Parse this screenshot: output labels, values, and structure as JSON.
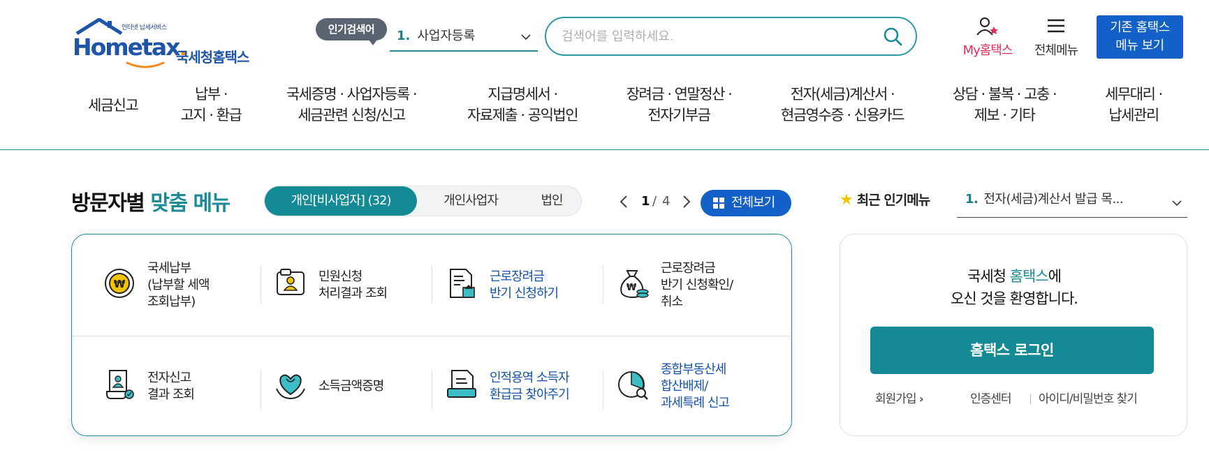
{
  "header": {
    "logo": {
      "small_text": "인터넷 납세서비스",
      "brand_text": "Hometax",
      "korean_text": "국세청홈택스"
    },
    "popular_search": {
      "badge": "인기검색어",
      "rank": "1.",
      "term": "사업자등록"
    },
    "search": {
      "placeholder": "검색어를 입력하세요."
    },
    "my_hometax_label": "My홈택스",
    "all_menu_label": "전체메뉴",
    "old_home_label_1": "기존 홈택스",
    "old_home_label_2": "메뉴 보기"
  },
  "gnb": [
    {
      "line1": "세금신고",
      "line2": ""
    },
    {
      "line1": "납부 ·",
      "line2": "고지 · 환급"
    },
    {
      "line1": "국세증명 · 사업자등록 ·",
      "line2": "세금관련 신청/신고"
    },
    {
      "line1": "지급명세서 ·",
      "line2": "자료제출 · 공익법인"
    },
    {
      "line1": "장려금 · 연말정산 ·",
      "line2": "전자기부금"
    },
    {
      "line1": "전자(세금)계산서 ·",
      "line2": "현금영수증 · 신용카드"
    },
    {
      "line1": "상담 · 불복 · 고충 ·",
      "line2": "제보 · 기타"
    },
    {
      "line1": "세무대리 ·",
      "line2": "납세관리"
    }
  ],
  "visitor_menu": {
    "title_prefix": "방문자별",
    "title_accent": "맞춤 메뉴",
    "tabs": [
      "개인[비사업자] (32)",
      "개인사업자",
      "법인"
    ],
    "active_tab": 0,
    "page_current": "1",
    "page_sep": "/",
    "page_total": "4",
    "view_all_label": "전체보기",
    "items": [
      {
        "label": "국세납부\n(납부할 세액\n조회납부)",
        "icon": "tax-payment-coin-icon",
        "highlight": false
      },
      {
        "label": "민원신청\n처리결과 조회",
        "icon": "petition-result-icon",
        "highlight": false
      },
      {
        "label": "근로장려금\n반기 신청하기",
        "icon": "incentive-apply-icon",
        "highlight": true
      },
      {
        "label": "근로장려금\n반기 신청확인/\n취소",
        "icon": "money-bag-icon",
        "highlight": false
      },
      {
        "label": "전자신고\n결과 조회",
        "icon": "e-filing-result-icon",
        "highlight": false
      },
      {
        "label": "소득금액증명",
        "icon": "income-certificate-icon",
        "highlight": false
      },
      {
        "label": "인적용역 소득자\n환급금 찾아주기",
        "icon": "refund-finder-icon",
        "highlight": true
      },
      {
        "label": "종합부동산세\n합산배제/\n과세특례 신고",
        "icon": "property-tax-chart-icon",
        "highlight": true
      }
    ]
  },
  "recent_popular": {
    "label": "최근 인기메뉴",
    "rank": "1.",
    "item": "전자(세금)계산서 발급 목..."
  },
  "login_panel": {
    "welcome_1_prefix": "국세청",
    "welcome_1_accent": "홈택스",
    "welcome_1_suffix": "에",
    "welcome_2": "오신 것을 환영합니다.",
    "login_button": "홈택스 로그인",
    "signup": "회원가입",
    "cert_center": "인증센터",
    "find_id_pw": "아이디/비밀번호 찾기"
  },
  "colors": {
    "teal": "#138a94",
    "blue": "#1260c8",
    "link_blue": "#1452b0",
    "pink": "#e0305a"
  }
}
